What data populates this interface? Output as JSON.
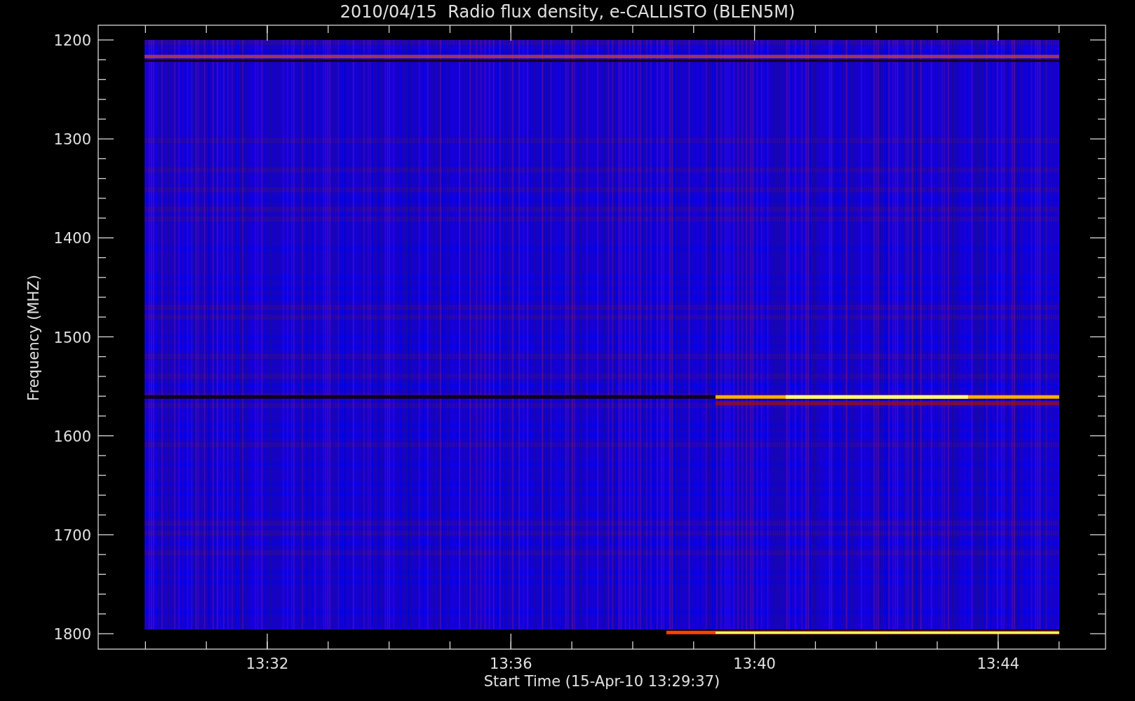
{
  "title": "2010/04/15  Radio flux density, e-CALLISTO (BLEN5M)",
  "y_axis": {
    "label": "Frequency (MHZ)",
    "ticks": [
      "1200",
      "1300",
      "1400",
      "1500",
      "1600",
      "1700",
      "1800"
    ]
  },
  "x_axis": {
    "label": "Start Time (15-Apr-10 13:29:37)",
    "ticks": [
      "13:32",
      "13:36",
      "13:40",
      "13:44"
    ]
  }
}
